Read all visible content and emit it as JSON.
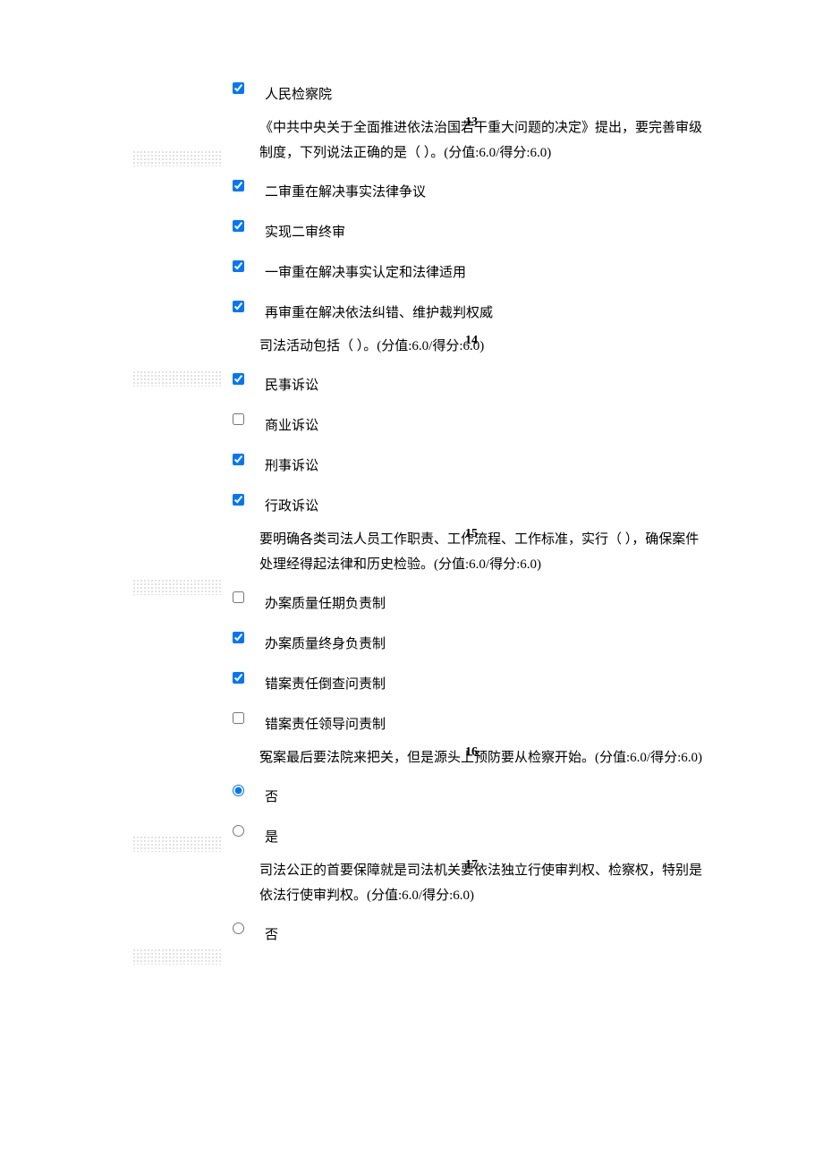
{
  "orphan_option": {
    "label": "人民检察院",
    "checked": true
  },
  "questions": [
    {
      "num": "13",
      "text": "《中共中央关于全面推进依法治国若干重大问题的决定》提出，要完善审级制度，下列说法正确的是（  ）。(分值:6.0/得分:6.0)",
      "type": "checkbox",
      "options": [
        {
          "label": "二审重在解决事实法律争议",
          "checked": true
        },
        {
          "label": "实现二审终审",
          "checked": true
        },
        {
          "label": "一审重在解决事实认定和法律适用",
          "checked": true
        },
        {
          "label": "再审重在解决依法纠错、维护裁判权威",
          "checked": true
        }
      ]
    },
    {
      "num": "14",
      "text": "司法活动包括（  ）。(分值:6.0/得分:6.0)",
      "type": "checkbox",
      "options": [
        {
          "label": "民事诉讼",
          "checked": true
        },
        {
          "label": "商业诉讼",
          "checked": false
        },
        {
          "label": "刑事诉讼",
          "checked": true
        },
        {
          "label": "行政诉讼",
          "checked": true
        }
      ]
    },
    {
      "num": "15",
      "text": "要明确各类司法人员工作职责、工作流程、工作标准，实行（  ），确保案件处理经得起法律和历史检验。(分值:6.0/得分:6.0)",
      "type": "checkbox",
      "options": [
        {
          "label": "办案质量任期负责制",
          "checked": false
        },
        {
          "label": "办案质量终身负责制",
          "checked": true
        },
        {
          "label": "错案责任倒查问责制",
          "checked": true
        },
        {
          "label": "错案责任领导问责制",
          "checked": false
        }
      ]
    },
    {
      "num": "16",
      "text": "冤案最后要法院来把关，但是源头上预防要从检察开始。(分值:6.0/得分:6.0)",
      "type": "radio",
      "options": [
        {
          "label": "否",
          "checked": true
        },
        {
          "label": "是",
          "checked": false
        }
      ]
    },
    {
      "num": "17",
      "text": "司法公正的首要保障就是司法机关要依法独立行使审判权、检察权，特别是依法行使审判权。(分值:6.0/得分:6.0)",
      "type": "radio",
      "options": [
        {
          "label": "否",
          "checked": false
        }
      ]
    }
  ],
  "stripe_offsets": [
    168,
    414,
    647,
    934,
    1060
  ]
}
